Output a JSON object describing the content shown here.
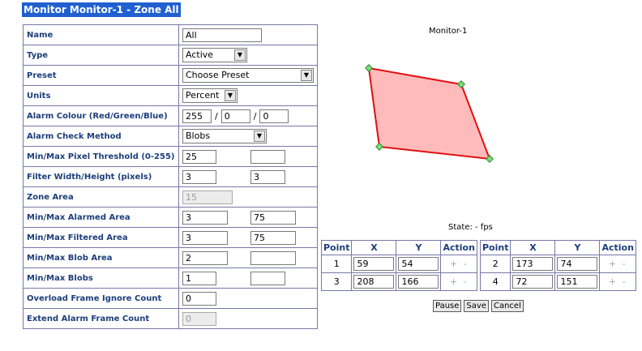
{
  "title": "Monitor Monitor-1 - Zone All",
  "form": {
    "name_label": "Name",
    "name_value": "All",
    "type_label": "Type",
    "type_value": "Active",
    "preset_label": "Preset",
    "preset_value": "Choose Preset",
    "units_label": "Units",
    "units_value": "Percent",
    "colour_label": "Alarm Colour (Red/Green/Blue)",
    "colour_r": "255",
    "colour_g": "0",
    "colour_b": "0",
    "colour_sep": "/",
    "check_label": "Alarm Check Method",
    "check_value": "Blobs",
    "pixel_label": "Min/Max Pixel Threshold (0-255)",
    "pixel_min": "25",
    "pixel_max": "",
    "filter_label": "Filter Width/Height (pixels)",
    "filter_w": "3",
    "filter_h": "3",
    "area_label": "Zone Area",
    "area_value": "15",
    "alarmed_label": "Min/Max Alarmed Area",
    "alarmed_min": "3",
    "alarmed_max": "75",
    "filtered_label": "Min/Max Filtered Area",
    "filtered_min": "3",
    "filtered_max": "75",
    "blobarea_label": "Min/Max Blob Area",
    "blobarea_min": "2",
    "blobarea_max": "",
    "blobs_label": "Min/Max Blobs",
    "blobs_min": "1",
    "blobs_max": "",
    "overload_label": "Overload Frame Ignore Count",
    "overload_value": "0",
    "extend_label": "Extend Alarm Frame Count",
    "extend_value": "0"
  },
  "preview": {
    "title": "Monitor-1",
    "fill_color": "#ffbbbb",
    "stroke_color": "#e01010",
    "handle_color": "#2a8a2a"
  },
  "state": "State:  -  fps",
  "points_headers": {
    "point": "Point",
    "x": "X",
    "y": "Y",
    "action": "Action"
  },
  "points": [
    {
      "point": "1",
      "x": "59",
      "y": "54",
      "action": "+ -"
    },
    {
      "point": "2",
      "x": "173",
      "y": "74",
      "action": "+ -"
    },
    {
      "point": "3",
      "x": "208",
      "y": "166",
      "action": "+ -"
    },
    {
      "point": "4",
      "x": "72",
      "y": "151",
      "action": "+ -"
    }
  ],
  "buttons": {
    "pause": "Pause",
    "save": "Save",
    "cancel": "Cancel"
  }
}
